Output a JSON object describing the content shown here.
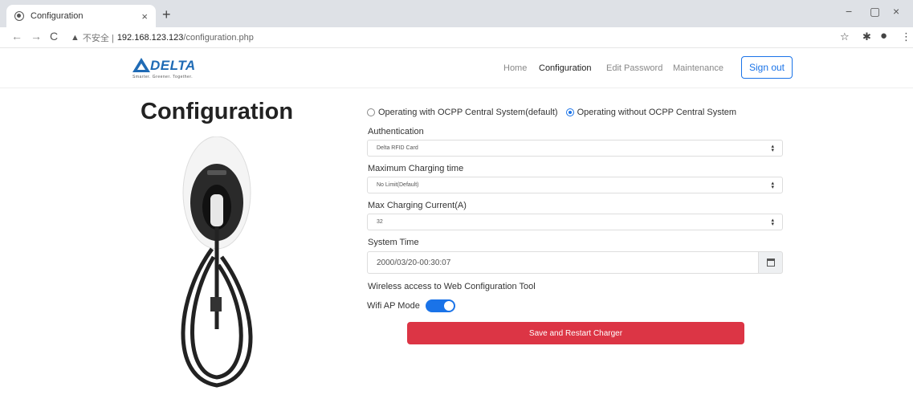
{
  "browser": {
    "tab_title": "Configuration",
    "tab_close": "×",
    "new_tab": "+",
    "window_controls": {
      "minimize": "−",
      "maximize": "▢",
      "close": "×"
    },
    "nav": {
      "back": "←",
      "forward": "→",
      "reload": "C"
    },
    "security_warning": "▲",
    "insecure_label": "不安全 |",
    "url_host": "192.168.123.123",
    "url_path": "/configuration.php",
    "toolbar_icons": {
      "star": "☆",
      "extensions": "✱",
      "profile": "●",
      "menu": "⋮"
    }
  },
  "header": {
    "logo_text": "DELTA",
    "logo_tagline": "Smarter. Greener. Together.",
    "nav": {
      "home": "Home",
      "configuration": "Configuration",
      "edit_password": "Edit Password",
      "maintenance": "Maintenance"
    },
    "sign_out": "Sign out"
  },
  "page": {
    "title": "Configuration"
  },
  "form": {
    "mode_options": [
      {
        "label": "Operating with OCPP Central System(default)",
        "checked": false
      },
      {
        "label": "Operating without OCPP Central System",
        "checked": true
      }
    ],
    "authentication": {
      "label": "Authentication",
      "value": "Delta RFID Card"
    },
    "max_charging_time": {
      "label": "Maximum Charging time",
      "value": "No Limit(Default)"
    },
    "max_charging_current": {
      "label": "Max Charging Current(A)",
      "value": "32"
    },
    "system_time": {
      "label": "System Time",
      "value": "2000/03/20-00:30:07"
    },
    "wireless_heading": "Wireless access to Web Configuration Tool",
    "wifi_ap_mode": {
      "label": "Wifi AP Mode",
      "enabled": true
    },
    "save_button": "Save and Restart Charger"
  },
  "colors": {
    "primary": "#1a73e8",
    "danger": "#dc3545",
    "logo_blue": "#1f6bb5"
  }
}
